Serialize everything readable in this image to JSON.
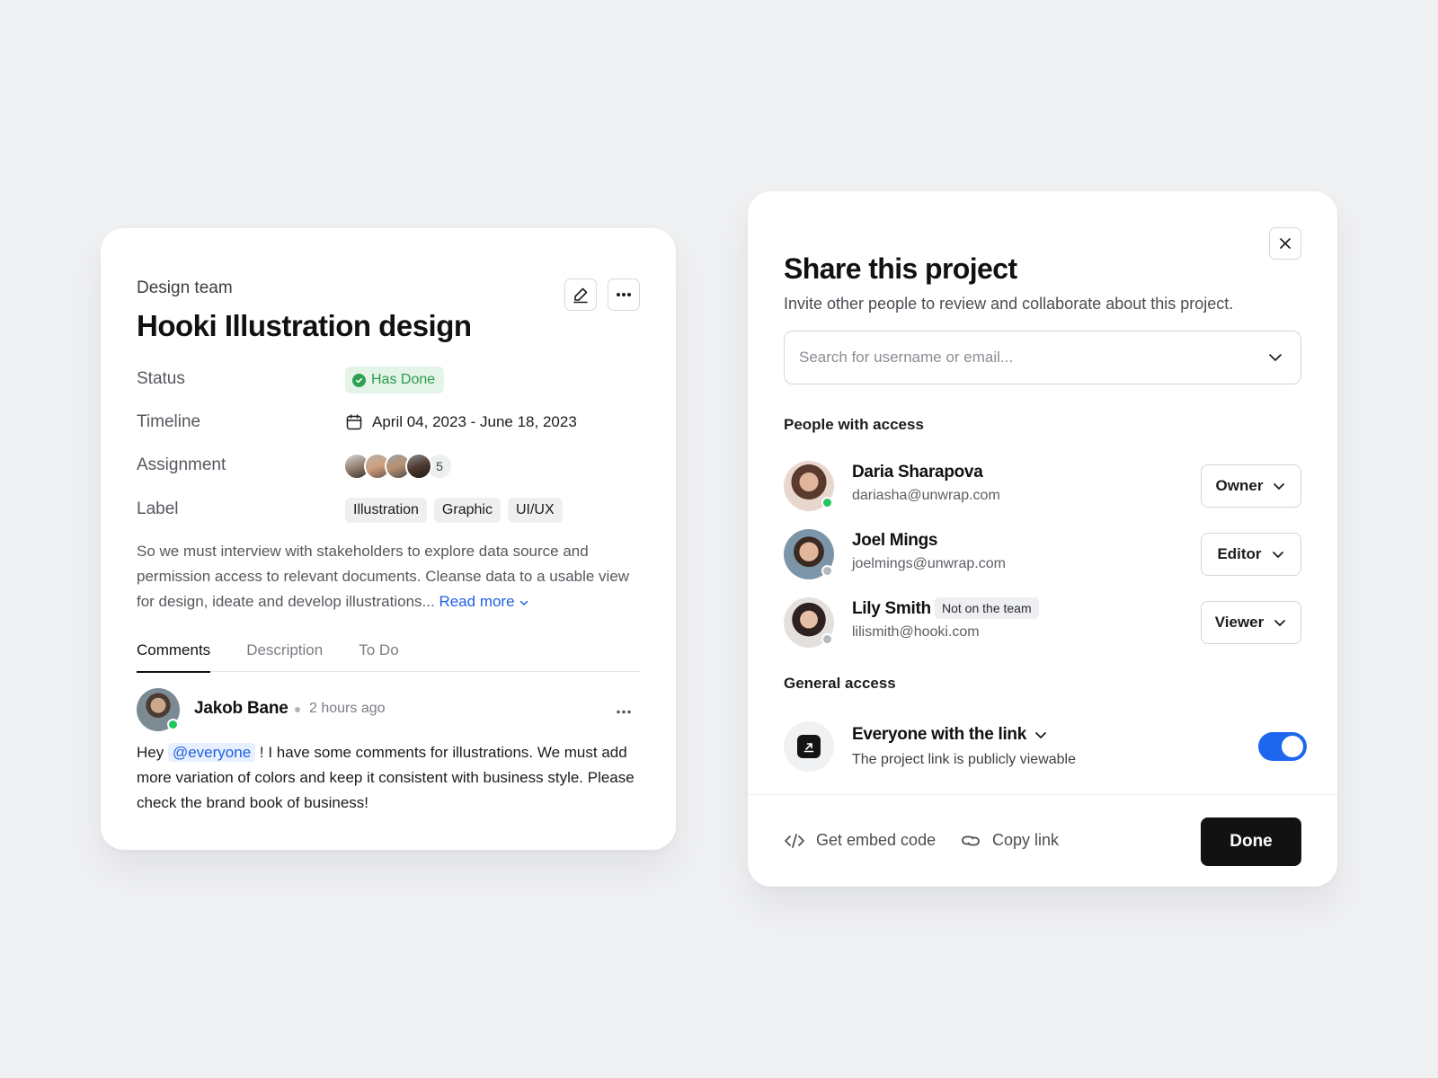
{
  "task_card": {
    "team": "Design team",
    "title": "Hooki Illustration design",
    "properties": {
      "status_label": "Status",
      "status_value": "Has Done",
      "timeline_label": "Timeline",
      "timeline_value": "April 04, 2023 - June 18, 2023",
      "assignment_label": "Assignment",
      "assignment_extra_count": "5",
      "label_label": "Label",
      "tags": [
        "Illustration",
        "Graphic",
        "UI/UX"
      ]
    },
    "description": "So we must interview with stakeholders to explore data source and permission access to relevant documents. Cleanse data to a usable view for design, ideate and develop illustrations...",
    "read_more": "Read more",
    "tabs": [
      "Comments",
      "Description",
      "To Do"
    ],
    "active_tab": "Comments",
    "comment": {
      "author": "Jakob Bane",
      "time": "2 hours ago",
      "text_before": "Hey ",
      "mention": "@everyone",
      "text_after": " ! I have some comments for illustrations. We must add more variation of colors and keep it consistent with business style. Please check the brand book of business!"
    }
  },
  "share_dialog": {
    "title": "Share this project",
    "subtitle": "Invite other people to review and collaborate about this project.",
    "search_placeholder": "Search for username or email...",
    "people_title": "People with access",
    "people": [
      {
        "name": "Daria Sharapova",
        "email": "dariasha@unwrap.com",
        "role": "Owner",
        "online": true,
        "badge": ""
      },
      {
        "name": "Joel Mings",
        "email": "joelmings@unwrap.com",
        "role": "Editor",
        "online": false,
        "badge": ""
      },
      {
        "name": "Lily Smith",
        "email": "lilismith@hooki.com",
        "role": "Viewer",
        "online": false,
        "badge": "Not on the team"
      }
    ],
    "general_title": "General access",
    "link_access": {
      "title": "Everyone with the link",
      "subtitle": "The project link is publicly viewable",
      "enabled": true
    },
    "footer": {
      "embed_label": "Get embed code",
      "copy_label": "Copy link",
      "done_label": "Done"
    }
  },
  "colors": {
    "accent_blue": "#1f66ee",
    "success_green": "#2fa052",
    "online_green": "#22c55e",
    "offline_gray": "#b5b8bd"
  },
  "icons": [
    "edit-icon",
    "more-icon",
    "check-circle-icon",
    "calendar-icon",
    "chevron-down-icon",
    "close-icon",
    "link-external-icon",
    "code-icon",
    "link-icon"
  ]
}
